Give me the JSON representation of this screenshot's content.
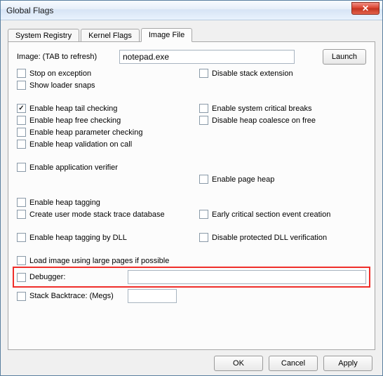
{
  "window": {
    "title": "Global Flags"
  },
  "tabs": {
    "registry": "System Registry",
    "kernel": "Kernel Flags",
    "image": "Image File"
  },
  "image": {
    "label": "Image: (TAB to refresh)",
    "value": "notepad.exe",
    "launch": "Launch"
  },
  "opts": {
    "stop_exception": "Stop on exception",
    "disable_stack_ext": "Disable stack extension",
    "show_loader_snaps": "Show loader snaps",
    "heap_tail": "Enable heap tail checking",
    "sys_crit_breaks": "Enable system critical breaks",
    "heap_free": "Enable heap free checking",
    "disable_coalesce": "Disable heap coalesce on free",
    "heap_param": "Enable heap parameter checking",
    "heap_valid_call": "Enable heap validation on call",
    "app_verifier": "Enable application verifier",
    "page_heap": "Enable page heap",
    "heap_tagging": "Enable heap tagging",
    "ust": "Create user mode stack trace database",
    "early_cs": "Early critical section event creation",
    "heap_tag_dll": "Enable heap tagging by DLL",
    "disable_prot_dll": "Disable protected DLL verification",
    "large_pages": "Load image using large pages if possible",
    "debugger": "Debugger:",
    "stack_backtrace": "Stack Backtrace: (Megs)"
  },
  "buttons": {
    "ok": "OK",
    "cancel": "Cancel",
    "apply": "Apply"
  }
}
